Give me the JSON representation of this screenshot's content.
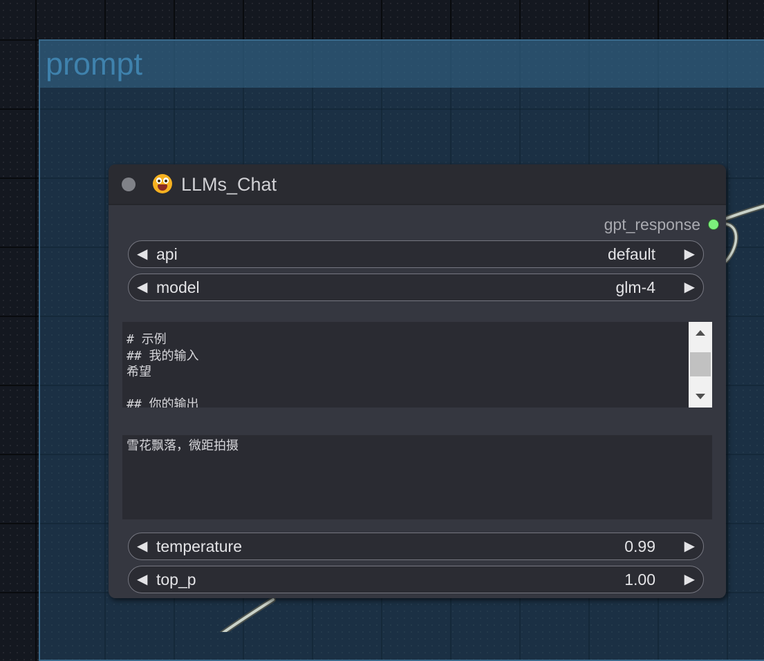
{
  "group": {
    "title": "prompt"
  },
  "node": {
    "title": "LLMs_Chat",
    "output_label": "gpt_response",
    "widgets": {
      "api": {
        "label": "api",
        "value": "default"
      },
      "model": {
        "label": "model",
        "value": "glm-4"
      },
      "temperature": {
        "label": "temperature",
        "value": "0.99"
      },
      "top_p": {
        "label": "top_p",
        "value": "1.00"
      }
    },
    "system_prompt_lines": [
      "# 示例",
      "## 我的输入",
      "希望",
      "",
      "## 你的输出"
    ],
    "user_prompt": "雪花飘落，微距拍摄"
  },
  "colors": {
    "output_dot": "#7cf07c",
    "group_title": "#3f82ad",
    "emoji_icon": "#f6b120"
  },
  "icons": {
    "collapse": "circle-dot-icon",
    "node_emoji": "grinning-face-icon",
    "arrow_left": "triangle-left-icon",
    "arrow_right": "triangle-right-icon"
  }
}
